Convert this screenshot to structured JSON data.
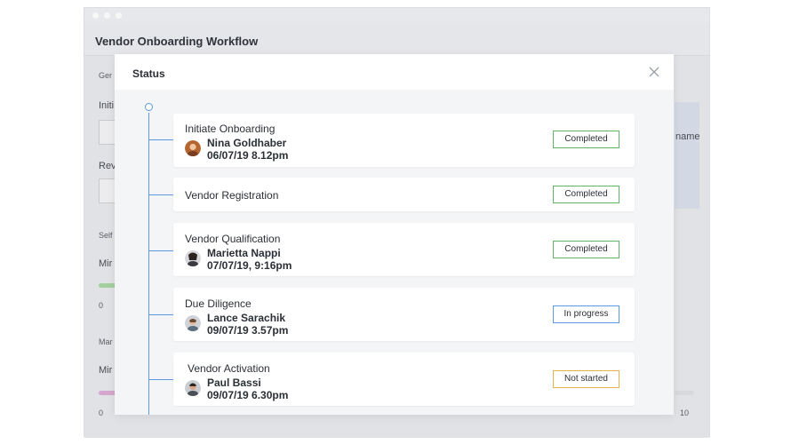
{
  "window": {
    "title": "Vendor Onboarding Workflow"
  },
  "background": {
    "labels": [
      "Ger",
      "Initi",
      "Rev",
      "Self",
      "Mir",
      "0",
      "Mar",
      "Mir",
      "0",
      "name",
      "10"
    ]
  },
  "modal": {
    "title": "Status",
    "close_label": "×"
  },
  "steps": [
    {
      "name": "Initiate Onboarding",
      "assignee": "Nina Goldhaber",
      "timestamp": "06/07/19 8.12pm",
      "status": "Completed"
    },
    {
      "name": "Vendor Registration",
      "status": "Completed"
    },
    {
      "name": "Vendor Qualification",
      "assignee": "Marietta Nappi",
      "timestamp": "07/07/19, 9:16pm",
      "status": "Completed"
    },
    {
      "name": "Due Diligence",
      "assignee": "Lance Sarachik",
      "timestamp": "09/07/19 3.57pm",
      "status": "In progress"
    },
    {
      "name": "Vendor Activation",
      "assignee": "Paul Bassi",
      "timestamp": "09/07/19 6.30pm",
      "status": "Not started"
    }
  ],
  "colors": {
    "completed": "#62b36a",
    "in_progress": "#5b9ae0",
    "not_started": "#e9b04e",
    "timeline": "#5b9ae0"
  }
}
